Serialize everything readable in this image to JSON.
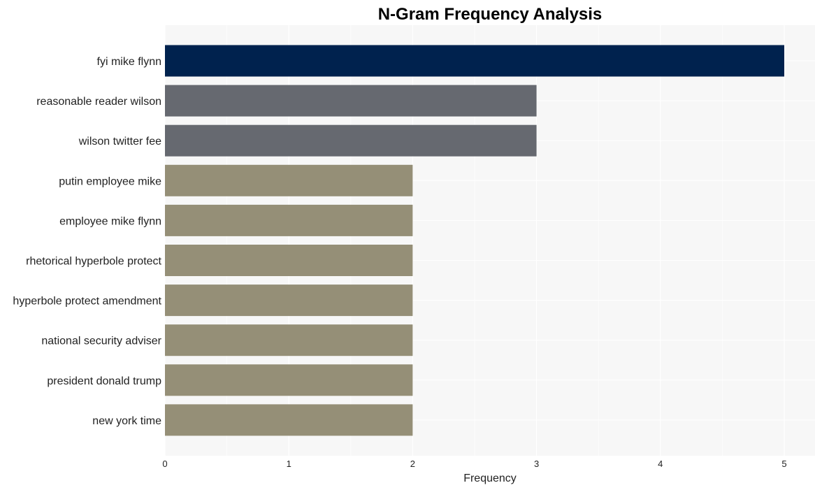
{
  "chart_data": {
    "type": "bar",
    "orientation": "horizontal",
    "title": "N-Gram Frequency Analysis",
    "xlabel": "Frequency",
    "ylabel": "",
    "xlim": [
      0,
      5.25
    ],
    "xticks": [
      0,
      1,
      2,
      3,
      4,
      5
    ],
    "grid": true,
    "categories": [
      "fyi mike flynn",
      "reasonable reader wilson",
      "wilson twitter fee",
      "putin employee mike",
      "employee mike flynn",
      "rhetorical hyperbole protect",
      "hyperbole protect amendment",
      "national security adviser",
      "president donald trump",
      "new york time"
    ],
    "values": [
      5,
      3,
      3,
      2,
      2,
      2,
      2,
      2,
      2,
      2
    ],
    "colors": [
      "#00224e",
      "#666970",
      "#666970",
      "#958f77",
      "#958f77",
      "#958f77",
      "#958f77",
      "#958f77",
      "#958f77",
      "#958f77"
    ]
  },
  "colors": {
    "plot_background": "#f7f7f7",
    "grid": "#ffffff"
  }
}
